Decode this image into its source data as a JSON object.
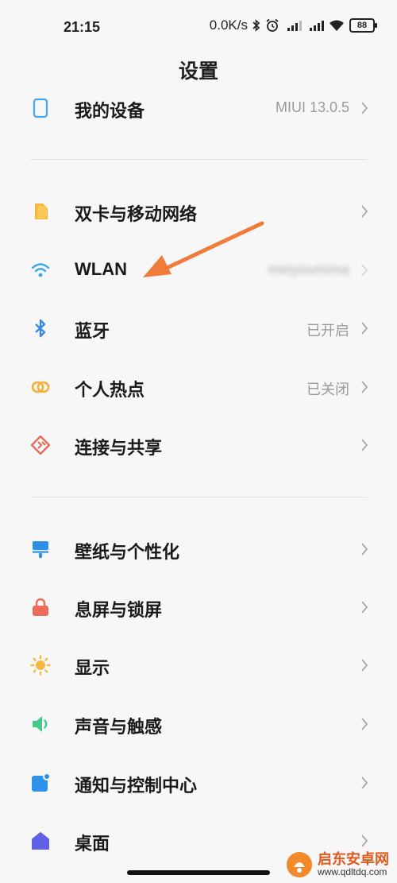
{
  "status": {
    "time": "21:15",
    "speed": "0.0K/s",
    "battery": "88"
  },
  "page_title": "设置",
  "sections": [
    [
      {
        "label": "我的设备",
        "value": "MIUI 13.0.5",
        "icon": "tablet-icon",
        "color": "#4aa3f0"
      }
    ],
    [
      {
        "label": "双卡与移动网络",
        "value": "",
        "icon": "sim-card-icon",
        "color": "#f4b93b"
      },
      {
        "label": "WLAN",
        "value": "meiyoumima",
        "icon": "wifi-icon",
        "color": "#39a7e5"
      },
      {
        "label": "蓝牙",
        "value": "已开启",
        "icon": "bluetooth-icon",
        "color": "#3d86e6"
      },
      {
        "label": "个人热点",
        "value": "已关闭",
        "icon": "hotspot-icon",
        "color": "#f0b238"
      },
      {
        "label": "连接与共享",
        "value": "",
        "icon": "share-icon",
        "color": "#e66a5a"
      }
    ],
    [
      {
        "label": "壁纸与个性化",
        "value": "",
        "icon": "wallpaper-icon",
        "color": "#2d8fe6"
      },
      {
        "label": "息屏与锁屏",
        "value": "",
        "icon": "lock-icon",
        "color": "#ee6a5a"
      },
      {
        "label": "显示",
        "value": "",
        "icon": "sun-icon",
        "color": "#f5b93e"
      },
      {
        "label": "声音与触感",
        "value": "",
        "icon": "speaker-icon",
        "color": "#47c98a"
      },
      {
        "label": "通知与控制中心",
        "value": "",
        "icon": "notification-icon",
        "color": "#2f92ea"
      },
      {
        "label": "桌面",
        "value": "",
        "icon": "home-icon",
        "color": "#6261e6"
      }
    ]
  ],
  "watermark": {
    "text": "启东安卓网",
    "url": "www.qdltdq.com"
  }
}
